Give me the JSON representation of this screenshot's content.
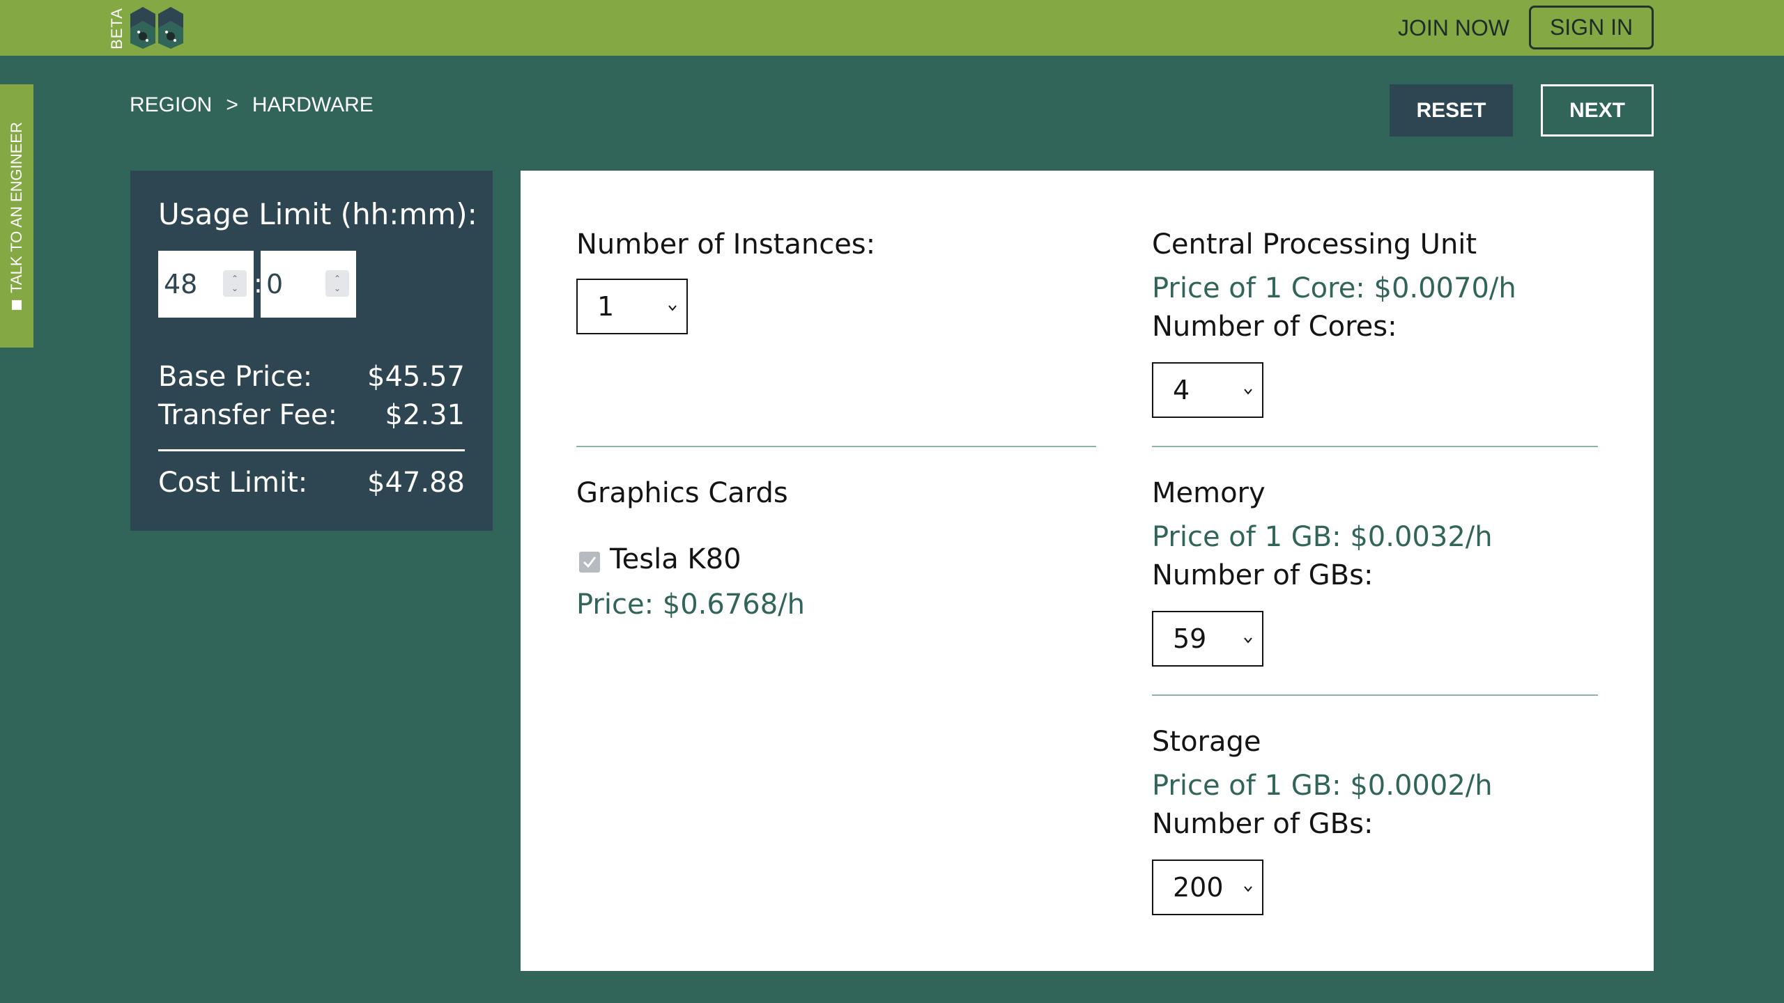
{
  "header": {
    "beta_label": "BETA",
    "join_label": "JOIN NOW",
    "sign_in_label": "SIGN IN"
  },
  "side_tab": {
    "label": "TALK TO AN ENGINEER"
  },
  "breadcrumb": {
    "items": [
      "REGION",
      "HARDWARE"
    ],
    "separator": ">"
  },
  "actions": {
    "reset_label": "RESET",
    "next_label": "NEXT"
  },
  "usage": {
    "title": "Usage Limit (hh:mm):",
    "hours": "48",
    "minutes": "0",
    "separator": ":",
    "base_price_label": "Base Price:",
    "base_price_value": "$45.57",
    "transfer_fee_label": "Transfer Fee:",
    "transfer_fee_value": "$2.31",
    "cost_limit_label": "Cost Limit:",
    "cost_limit_value": "$47.88"
  },
  "instances": {
    "label": "Number of Instances:",
    "value": "1"
  },
  "gpu": {
    "title": "Graphics Cards",
    "card_name": "Tesla K80",
    "card_checked": true,
    "price": "Price: $0.6768/h"
  },
  "cpu": {
    "title": "Central Processing Unit",
    "price": "Price of 1 Core: $0.0070/h",
    "count_label": "Number of Cores:",
    "value": "4"
  },
  "memory": {
    "title": "Memory",
    "price": "Price of 1 GB: $0.0032/h",
    "count_label": "Number of GBs:",
    "value": "59"
  },
  "storage": {
    "title": "Storage",
    "price": "Price of 1 GB: $0.0002/h",
    "count_label": "Number of GBs:",
    "value": "200"
  },
  "colors": {
    "header_green": "#84a844",
    "page_teal": "#31655a",
    "panel_dark": "#2e4552",
    "price_green": "#31655a"
  }
}
